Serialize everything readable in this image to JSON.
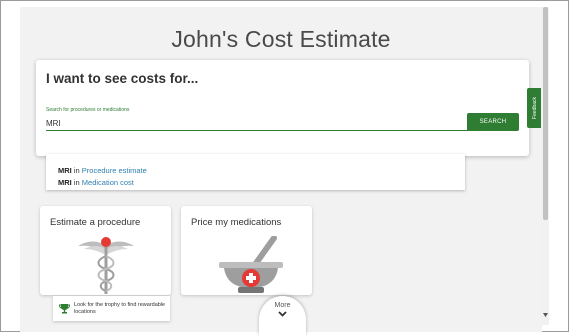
{
  "page": {
    "title": "John's Cost Estimate"
  },
  "search": {
    "heading": "I want to see costs for...",
    "label": "Search for procedures or medications",
    "value": "MRI",
    "button": "SEARCH"
  },
  "suggestions": [
    {
      "term": "MRI",
      "connector": "in",
      "category": "Procedure estimate"
    },
    {
      "term": "MRI",
      "connector": "in",
      "category": "Medication cost"
    }
  ],
  "tiles": [
    {
      "title": "Estimate a procedure",
      "icon": "caduceus-icon"
    },
    {
      "title": "Price my medications",
      "icon": "mortar-pestle-icon"
    }
  ],
  "trophy": {
    "text": "Look for the trophy to find rewardable locations",
    "icon": "trophy-icon"
  },
  "more": {
    "label": "More",
    "icon": "chevron-down-icon"
  },
  "feedback": {
    "label": "Feedback"
  },
  "colors": {
    "accent": "#2e7d32",
    "link": "#2f7fb0",
    "red": "#e53935",
    "gray": "#9e9e9e"
  }
}
